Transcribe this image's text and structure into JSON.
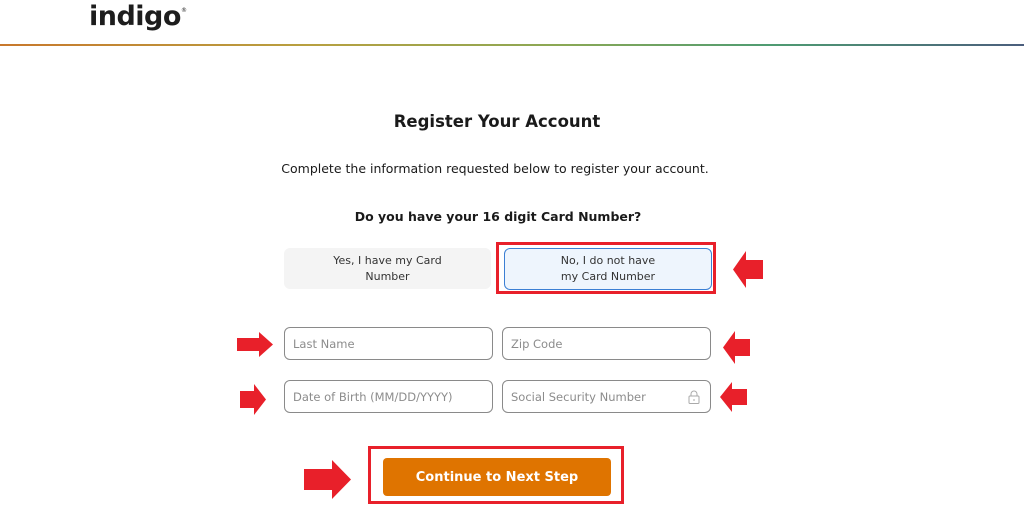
{
  "header": {
    "logo_text": "indigo",
    "logo_mark": "®"
  },
  "page": {
    "title": "Register Your Account",
    "subtitle": "Complete the information requested below to register your account.",
    "question": "Do you have your 16 digit Card Number?"
  },
  "card_choice": {
    "options": [
      {
        "label": "Yes, I have my Card Number",
        "selected": false
      },
      {
        "label": "No, I do not have my Card Number",
        "selected": true
      }
    ]
  },
  "form": {
    "last_name": {
      "value": "",
      "placeholder": "Last Name"
    },
    "zip_code": {
      "value": "",
      "placeholder": "Zip Code"
    },
    "date_of_birth": {
      "value": "",
      "placeholder": "Date of Birth (MM/DD/YYYY)"
    },
    "ssn": {
      "value": "",
      "placeholder": "Social Security Number",
      "icon": "lock-icon"
    },
    "submit_label": "Continue to Next Step"
  },
  "colors": {
    "primary_button": "#df7400",
    "selected_border": "#3b7fd4",
    "annotation": "#e8202a"
  },
  "annotations": {
    "arrows": [
      {
        "target": "no-card-button",
        "direction": "left"
      },
      {
        "target": "last-name-input",
        "direction": "right"
      },
      {
        "target": "zip-code-input",
        "direction": "left"
      },
      {
        "target": "dob-input",
        "direction": "right"
      },
      {
        "target": "ssn-input",
        "direction": "left"
      },
      {
        "target": "continue-button",
        "direction": "right"
      }
    ]
  }
}
